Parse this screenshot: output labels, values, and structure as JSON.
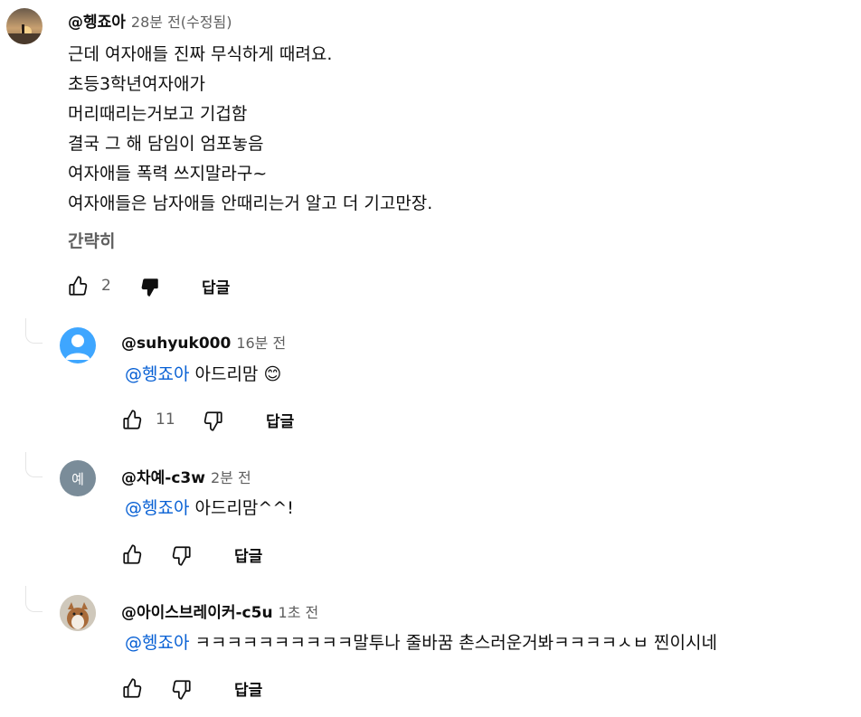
{
  "main_comment": {
    "handle": "@헹죠아",
    "time": "28분 전(수정됨)",
    "lines": [
      "근데 여자애들 진짜 무식하게 때려요.",
      "초등3학년여자애가",
      "머리때리는거보고 기겁함",
      "결국 그 해 담임이  엄포놓음",
      "여자애들 폭력 쓰지말라구~",
      "여자애들은 남자애들 안때리는거 알고 더 기고만장."
    ],
    "read_less": "간략히",
    "likes": "2",
    "reply_label": "답글"
  },
  "replies": [
    {
      "handle": "@suhyuk000",
      "time": "16분 전",
      "mention": "@헹죠아",
      "text": "  아드리맘",
      "emoji": "😊",
      "likes": "11",
      "reply_label": "답글"
    },
    {
      "handle": "@차예-c3w",
      "time": "2분 전",
      "avatar_letter": "예",
      "mention": "@헹죠아",
      "text": " 아드리맘^^!",
      "likes": "",
      "reply_label": "답글"
    },
    {
      "handle": "@아이스브레이커-c5u",
      "time": "1초 전",
      "mention": "@헹죠아",
      "text": "  ㅋㅋㅋㅋㅋㅋㅋㅋㅋㅋ말투나 줄바꿈 촌스러운거봐ㅋㅋㅋㅋㅅㅂ 찐이시네",
      "likes": "",
      "reply_label": "답글"
    }
  ],
  "colors": {
    "mention": "#065fd4",
    "secondary_text": "#606060",
    "avatar_blue": "#3ea6ff",
    "avatar_gray": "#7a8c99"
  },
  "icons": [
    "thumbs-up-icon",
    "thumbs-down-icon",
    "default-user-icon"
  ]
}
